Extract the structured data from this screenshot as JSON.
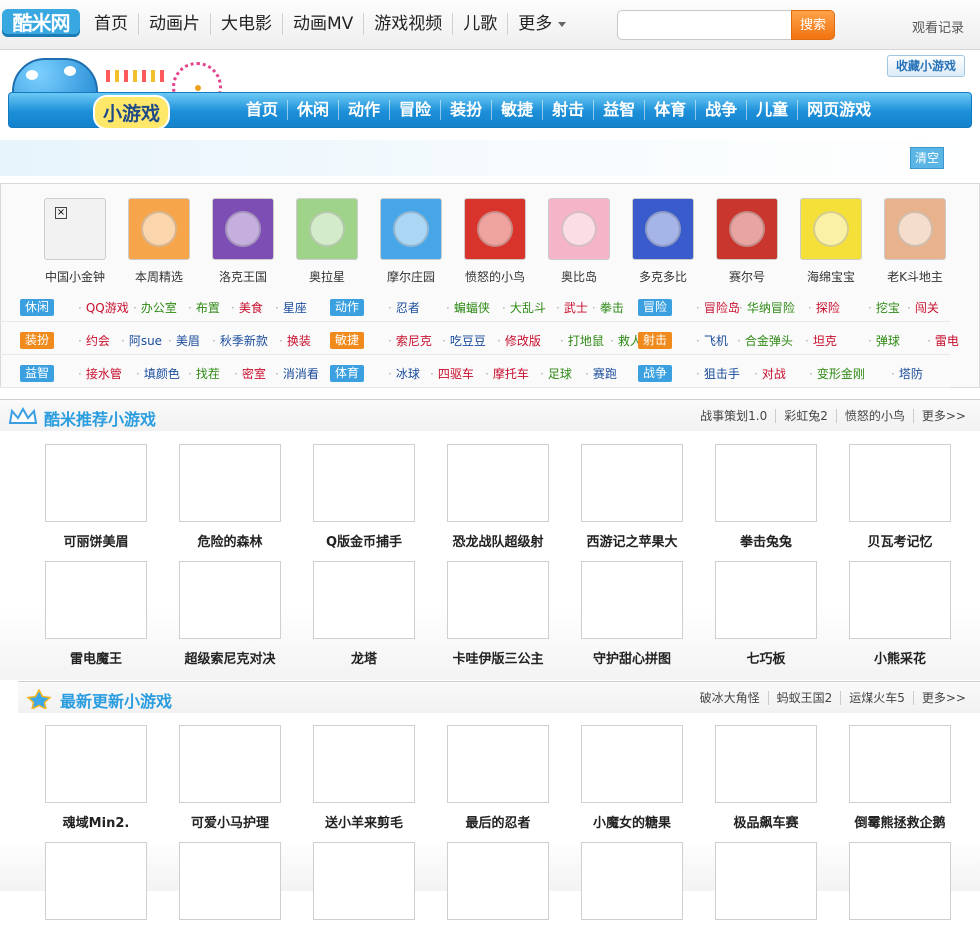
{
  "top_nav": {
    "logo": "酷米网",
    "items": [
      "首页",
      "动画片",
      "大电影",
      "动画MV",
      "游戏视频",
      "儿歌",
      "更多"
    ],
    "search_placeholder": "",
    "search_button": "搜索",
    "history": "观看记录"
  },
  "banner": {
    "title": "小游戏",
    "favorite": "收藏小游戏",
    "nav": [
      "首页",
      "休闲",
      "动作",
      "冒险",
      "装扮",
      "敏捷",
      "射击",
      "益智",
      "体育",
      "战争",
      "儿童",
      "网页游戏"
    ]
  },
  "history_strip": {
    "clear": "清空"
  },
  "featured_icons": [
    {
      "name": "中国小金钟",
      "color": "#f2f2f2",
      "icon": "broken-image-icon"
    },
    {
      "name": "本周精选",
      "color": "#f6a54a",
      "icon": "cartoon-kids-icon"
    },
    {
      "name": "洛克王国",
      "color": "#7d4fb5",
      "icon": "rocco-hero-icon"
    },
    {
      "name": "奥拉星",
      "color": "#9fd38a",
      "icon": "aola-star-icon"
    },
    {
      "name": "摩尔庄园",
      "color": "#46a6e8",
      "icon": "mole-icon"
    },
    {
      "name": "愤怒的小鸟",
      "color": "#d9342b",
      "icon": "angry-bird-icon"
    },
    {
      "name": "奥比岛",
      "color": "#f6b4c8",
      "icon": "aobi-hamster-icon"
    },
    {
      "name": "多克多比",
      "color": "#3a5bcc",
      "icon": "crystal-icon"
    },
    {
      "name": "赛尔号",
      "color": "#c9362d",
      "icon": "seer-robot-icon"
    },
    {
      "name": "海绵宝宝",
      "color": "#f5e03a",
      "icon": "spongebob-icon"
    },
    {
      "name": "老K斗地主",
      "color": "#e8b38c",
      "icon": "old-k-icon"
    }
  ],
  "tag_rows": [
    [
      {
        "label": "休闲",
        "chip_color": "#3aa0e0",
        "links": [
          [
            "QQ游戏",
            "red"
          ],
          [
            "办公室",
            "green"
          ],
          [
            "布置",
            "green"
          ],
          [
            "美食",
            "red"
          ],
          [
            "星座",
            "blue"
          ]
        ]
      },
      {
        "label": "动作",
        "chip_color": "#3aa0e0",
        "links": [
          [
            "忍者",
            "blue"
          ],
          [
            "蝙蝠侠",
            "green"
          ],
          [
            "大乱斗",
            "green"
          ],
          [
            "武士",
            "red"
          ],
          [
            "拳击",
            "green"
          ]
        ]
      },
      {
        "label": "冒险",
        "chip_color": "#3aa0e0",
        "links": [
          [
            "冒险岛",
            "red"
          ],
          [
            "华纳冒险",
            "green"
          ],
          [
            "探险",
            "red"
          ],
          [
            "挖宝",
            "green"
          ],
          [
            "闯关",
            "red"
          ]
        ]
      }
    ],
    [
      {
        "label": "装扮",
        "chip_color": "#f08a1c",
        "links": [
          [
            "约会",
            "red"
          ],
          [
            "阿sue",
            "blue"
          ],
          [
            "美眉",
            "blue"
          ],
          [
            "秋季新款",
            "blue"
          ],
          [
            "换装",
            "red"
          ]
        ]
      },
      {
        "label": "敏捷",
        "chip_color": "#f08a1c",
        "links": [
          [
            "索尼克",
            "red"
          ],
          [
            "吃豆豆",
            "blue"
          ],
          [
            "修改版",
            "red"
          ],
          [
            "打地鼠",
            "green"
          ],
          [
            "救人",
            "green"
          ]
        ]
      },
      {
        "label": "射击",
        "chip_color": "#f08a1c",
        "links": [
          [
            "飞机",
            "blue"
          ],
          [
            "合金弹头",
            "green"
          ],
          [
            "坦克",
            "red"
          ],
          [
            "弹球",
            "green"
          ],
          [
            "雷电",
            "red"
          ]
        ]
      }
    ],
    [
      {
        "label": "益智",
        "chip_color": "#3aa0e0",
        "links": [
          [
            "接水管",
            "red"
          ],
          [
            "填颜色",
            "blue"
          ],
          [
            "找茬",
            "green"
          ],
          [
            "密室",
            "red"
          ],
          [
            "消消看",
            "blue"
          ]
        ]
      },
      {
        "label": "体育",
        "chip_color": "#3aa0e0",
        "links": [
          [
            "冰球",
            "blue"
          ],
          [
            "四驱车",
            "red"
          ],
          [
            "摩托车",
            "red"
          ],
          [
            "足球",
            "green"
          ],
          [
            "赛跑",
            "blue"
          ]
        ]
      },
      {
        "label": "战争",
        "chip_color": "#3aa0e0",
        "links": [
          [
            "狙击手",
            "blue"
          ],
          [
            "对战",
            "red"
          ],
          [
            "变形金刚",
            "green"
          ],
          [
            "塔防",
            "blue"
          ]
        ]
      }
    ]
  ],
  "recommended": {
    "title": "酷米推荐小游戏",
    "links": [
      "战事策划1.0",
      "彩虹兔2",
      "愤怒的小鸟",
      "更多>>"
    ],
    "games": [
      "可丽饼美眉",
      "危险的森林",
      "Q版金币捕手",
      "恐龙战队超级射",
      "西游记之苹果大",
      "拳击兔兔",
      "贝瓦考记忆",
      "雷电魔王",
      "超级索尼克对决",
      "龙塔",
      "卡哇伊版三公主",
      "守护甜心拼图",
      "七巧板",
      "小熊采花"
    ]
  },
  "latest": {
    "title": "最新更新小游戏",
    "links": [
      "破冰大角怪",
      "蚂蚁王国2",
      "运煤火车5",
      "更多>>"
    ],
    "games": [
      "魂域Min2.",
      "可爱小马护理",
      "送小羊来剪毛",
      "最后的忍者",
      "小魔女的糖果",
      "极品飙车赛",
      "倒霉熊拯救企鹅",
      "",
      "",
      "",
      "",
      "",
      "",
      ""
    ]
  },
  "colors": {
    "accent_blue": "#2a9de0",
    "search_orange": "#f1730f",
    "link_red": "#c8102e",
    "link_green": "#2f8a16",
    "link_blue": "#1a4c9c"
  }
}
